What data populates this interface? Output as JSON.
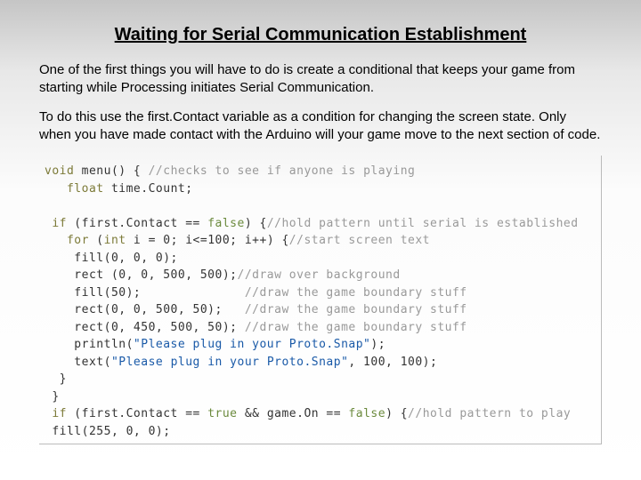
{
  "title": "Waiting for Serial Communication Establishment",
  "para1": "One of the first things you will have to do is create a conditional that keeps your game from starting while Processing initiates Serial Communication.",
  "para2": "To do this use the first.Contact variable as a condition for changing the screen state. Only when you have made contact with the Arduino will your game move to the next section of code.",
  "code": {
    "l1a": "void",
    "l1b": " menu() { ",
    "l1c": "//checks to see if anyone is playing",
    "l2a": "   float",
    "l2b": " time.Count;",
    "l3": "",
    "l4a": " if",
    "l4b": " (first.Contact == ",
    "l4c": "false",
    "l4d": ") {",
    "l4e": "//hold pattern until serial is established",
    "l5a": "   for",
    "l5b": " (",
    "l5c": "int",
    "l5d": " i = 0; i<=100; i++) {",
    "l5e": "//start screen text",
    "l6a": "    fill(0, 0, 0);",
    "l7a": "    rect (0, 0, 500, 500);",
    "l7b": "//draw over background",
    "l8a": "    fill(50);              ",
    "l8b": "//draw the game boundary stuff",
    "l9a": "    rect(0, 0, 500, 50);   ",
    "l9b": "//draw the game boundary stuff",
    "l10a": "    rect(0, 450, 500, 50); ",
    "l10b": "//draw the game boundary stuff",
    "l11a": "    println(",
    "l11b": "\"Please plug in your Proto.Snap\"",
    "l11c": ");",
    "l12a": "    text(",
    "l12b": "\"Please plug in your Proto.Snap\"",
    "l12c": ", 100, 100);",
    "l13": "  }",
    "l14": " }",
    "l15a": " if",
    "l15b": " (first.Contact == ",
    "l15c": "true",
    "l15d": " && game.On == ",
    "l15e": "false",
    "l15f": ") {",
    "l15g": "//hold pattern to play",
    "l16": " fill(255, 0, 0);"
  }
}
